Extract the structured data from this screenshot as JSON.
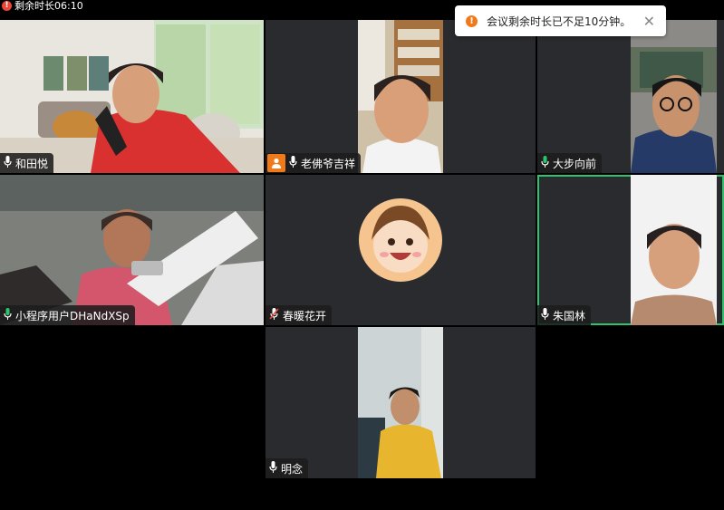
{
  "timer": {
    "text": "剩余时长06:10",
    "icon": "warning-dot-icon"
  },
  "toast": {
    "text": "会议剩余时长已不足10分钟。",
    "close": "✕"
  },
  "participants": [
    {
      "name": "和田悦",
      "mic": "on"
    },
    {
      "name": "老佛爷吉祥",
      "mic": "on"
    },
    {
      "name": "大步向前",
      "mic": "active"
    },
    {
      "name": "小程序用户DHaNdXSp",
      "mic": "active"
    },
    {
      "name": "春暖花开",
      "mic": "muted"
    },
    {
      "name": "朱国林",
      "mic": "on",
      "speaking": true
    },
    {
      "name": "明念",
      "mic": "on"
    }
  ],
  "colors": {
    "speaking_border": "#2ec46b",
    "warning": "#f07a1a",
    "alert_red": "#e8473a"
  }
}
